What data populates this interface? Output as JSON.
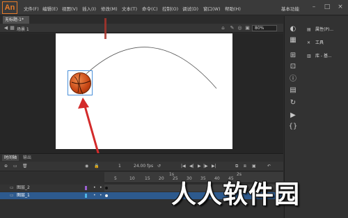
{
  "app": {
    "logo_text": "An",
    "workspace": "基本功能"
  },
  "menu": [
    "文件(F)",
    "编辑(E)",
    "视图(V)",
    "插入(I)",
    "修改(M)",
    "文本(T)",
    "命令(C)",
    "控制(O)",
    "调试(D)",
    "窗口(W)",
    "帮助(H)"
  ],
  "document": {
    "tab_label": "无标题-1*",
    "scene_label": "场景 1",
    "zoom": "80%"
  },
  "right_panel": {
    "entries": [
      {
        "icon": "properties-icon",
        "label": "属性(P)..."
      },
      {
        "icon": "tools-icon",
        "label": "工具"
      },
      {
        "icon": "library-icon",
        "label": "库 - 基..."
      }
    ]
  },
  "timeline": {
    "tabs": [
      "时间轴",
      "输出"
    ],
    "toolbar": {
      "fps": "24.00 fps",
      "frame": "1",
      "time": "0.0 s"
    },
    "ruler_numbers": [
      "1s",
      "5",
      "10",
      "15",
      "20",
      "25",
      "30",
      "35",
      "40",
      "45",
      "2s"
    ],
    "layers": [
      {
        "name": "图层_2",
        "selected": false,
        "color": "#9a5fd0"
      },
      {
        "name": "图层_1",
        "selected": true,
        "color": "#4fb5e6"
      }
    ]
  },
  "watermark": "人人软件园",
  "colors": {
    "accent": "#e67b2a",
    "selection": "#2d5a8e",
    "arrow": "#d32b2b",
    "path": "#555555"
  }
}
